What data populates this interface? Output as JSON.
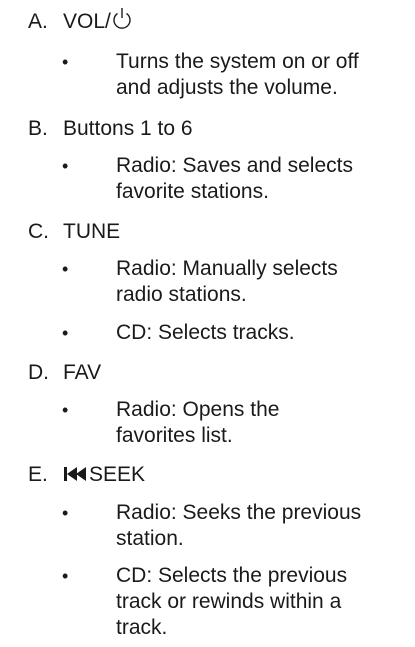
{
  "items": [
    {
      "letter": "A.",
      "label": "VOL/",
      "icon": "power-icon",
      "bullets": [
        {
          "symbol": "•",
          "lines": [
            "Turns the system on or off",
            "and adjusts the volume."
          ]
        }
      ]
    },
    {
      "letter": "B.",
      "label": "Buttons 1 to 6",
      "bullets": [
        {
          "symbol": "•",
          "lines": [
            "Radio: Saves and selects",
            "favorite stations."
          ]
        }
      ]
    },
    {
      "letter": "C.",
      "label": "TUNE",
      "bullets": [
        {
          "symbol": "•",
          "lines": [
            "Radio: Manually selects",
            "radio stations."
          ]
        },
        {
          "symbol": "•",
          "lines": [
            "CD: Selects tracks."
          ]
        }
      ]
    },
    {
      "letter": "D.",
      "label": "FAV",
      "bullets": [
        {
          "symbol": "•",
          "lines": [
            "Radio: Opens the",
            "favorites list."
          ]
        }
      ]
    },
    {
      "letter": "E.",
      "label": "SEEK",
      "icon": "seek-back-icon",
      "bullets": [
        {
          "symbol": "•",
          "lines": [
            "Radio: Seeks the previous",
            "station."
          ]
        },
        {
          "symbol": "•",
          "lines": [
            "CD: Selects the previous",
            "track or rewinds within a",
            "track."
          ]
        }
      ]
    }
  ]
}
